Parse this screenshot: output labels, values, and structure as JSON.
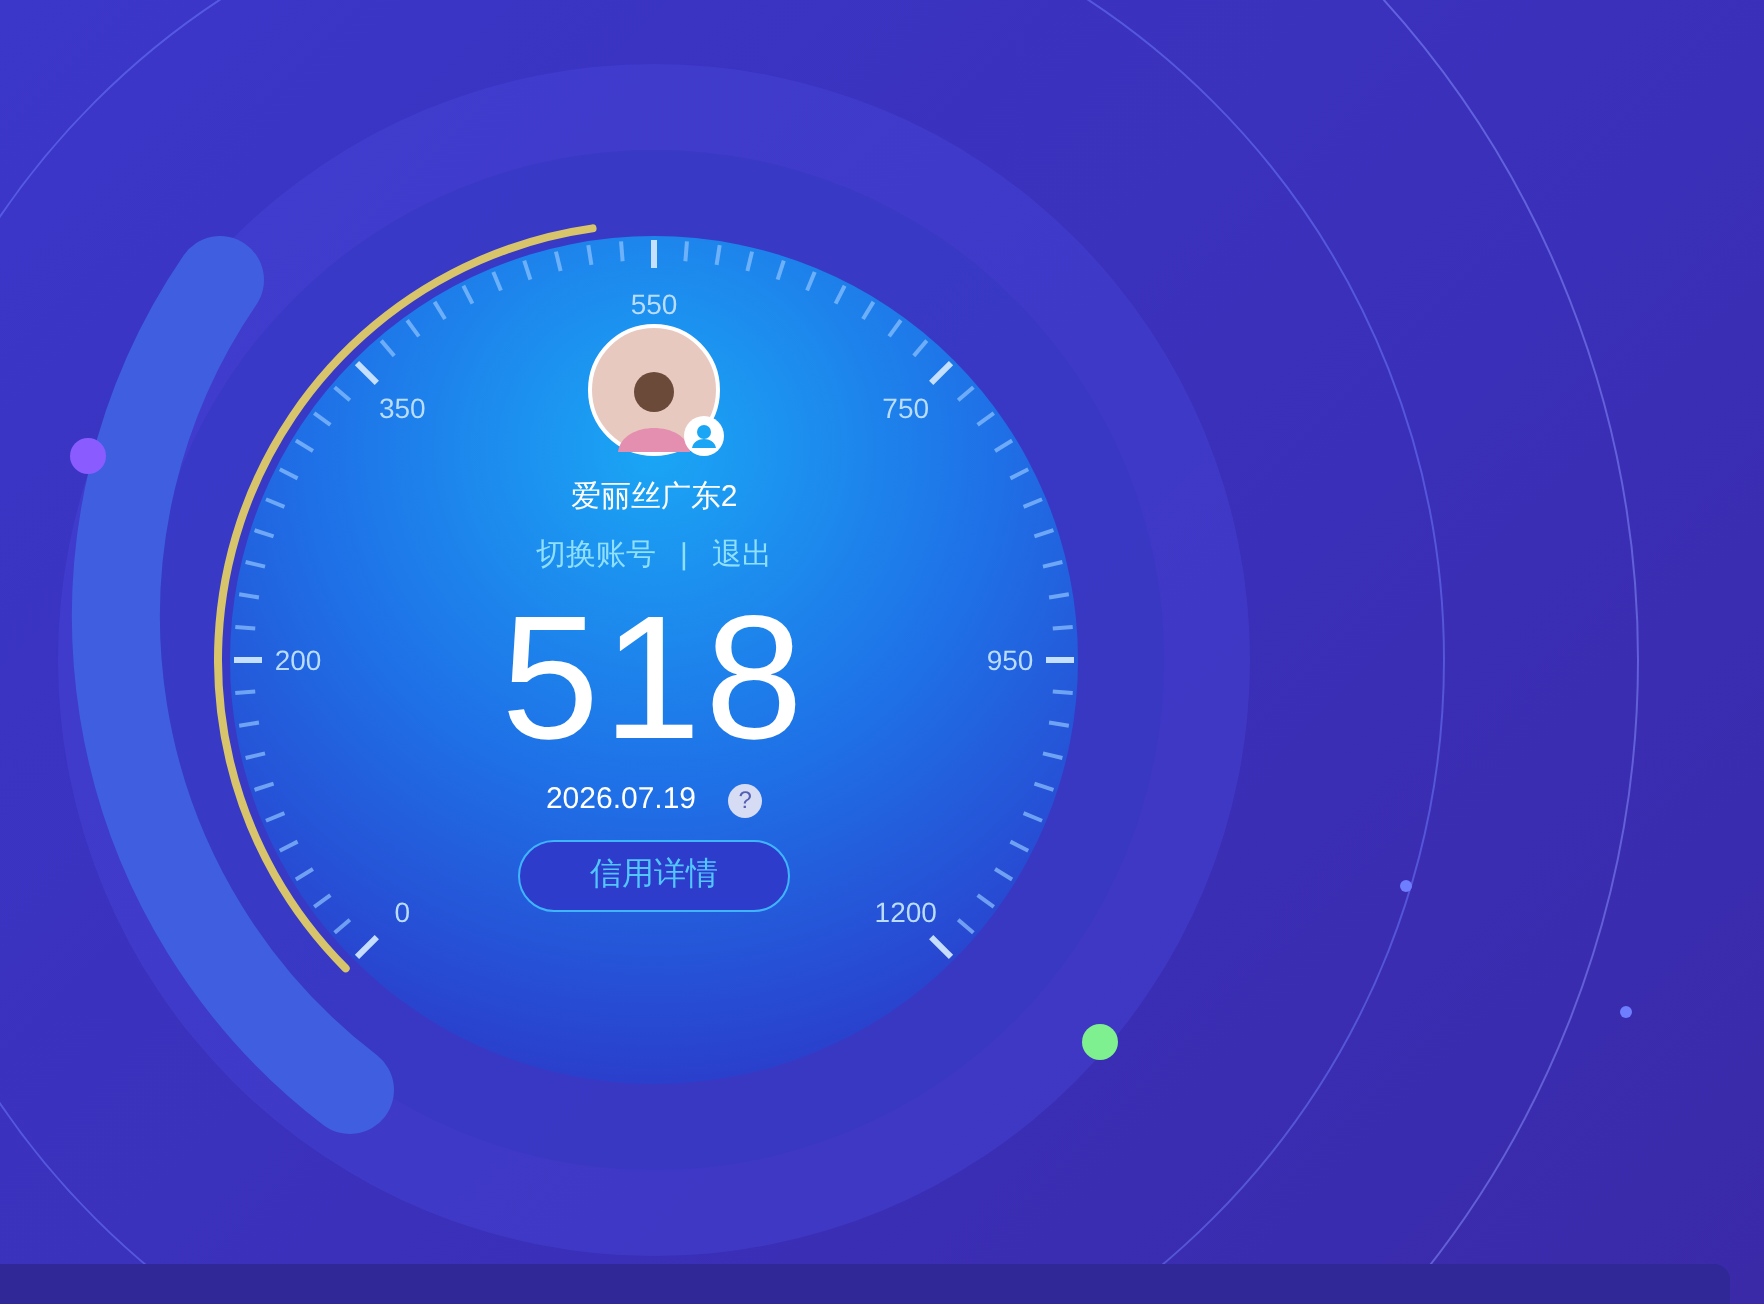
{
  "gauge": {
    "scale_labels": [
      "0",
      "200",
      "350",
      "550",
      "750",
      "950",
      "1200"
    ],
    "level": 0.47
  },
  "user": {
    "name": "爱丽丝广东2",
    "switch_account": "切换账号",
    "separator": "|",
    "logout": "退出"
  },
  "score": "518",
  "date": "2026.07.19",
  "help_icon": "?",
  "details_button": "信用详情"
}
